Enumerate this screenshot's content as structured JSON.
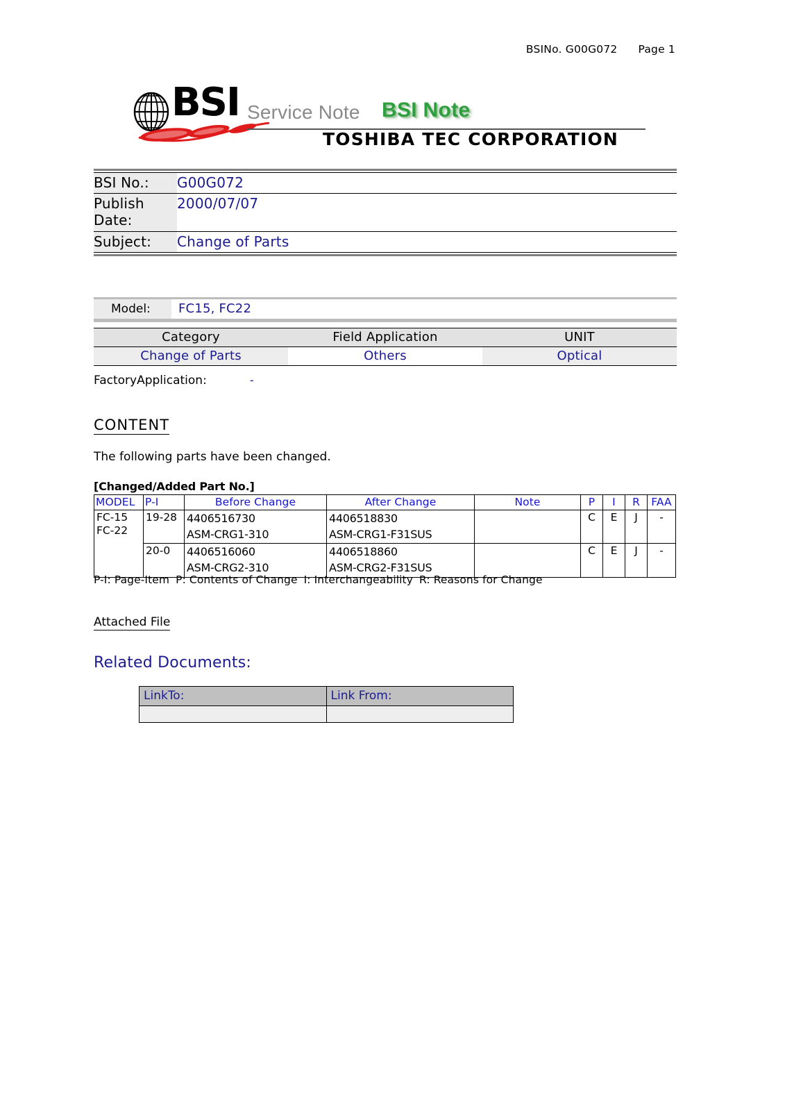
{
  "header": {
    "bsi_no_label": "BSINo. G00G072",
    "page_label": "Page 1"
  },
  "logo": {
    "bsi_word": "BSI",
    "service_note": "Service Note",
    "bsi_note": "BSI Note",
    "company": "TOSHIBA TEC CORPORATION",
    "globe_icon": "globe-icon",
    "swoosh_icon": "red-swoosh-icon"
  },
  "info": {
    "rows": [
      {
        "label": "BSI No.:",
        "value": "G00G072"
      },
      {
        "label_line1": "Publish",
        "label_line2": "Date:",
        "value": "2000/07/07"
      },
      {
        "label": "Subject:",
        "value": "Change of Parts"
      }
    ]
  },
  "model": {
    "label": "Model:",
    "value": "FC15, FC22"
  },
  "category_table": {
    "headers": [
      "Category",
      "Field Application",
      "UNIT"
    ],
    "values": [
      "Change of Parts",
      "Others",
      "Optical"
    ]
  },
  "factory": {
    "label": "FactoryApplication:",
    "value": "-"
  },
  "content": {
    "heading": "CONTENT",
    "body": "The following parts have been changed."
  },
  "parts": {
    "title": "[Changed/Added Part No.]",
    "headers": [
      "MODEL",
      "P-I",
      "Before Change",
      "After Change",
      "Note",
      "P",
      "I",
      "R",
      "FAA"
    ],
    "model_cell_line1": "FC-15",
    "model_cell_line2": "FC-22",
    "rows": [
      {
        "pi": "19-28",
        "before_line1": "4406516730",
        "before_line2": "ASM-CRG1-310",
        "after_line1": "4406518830",
        "after_line2": "ASM-CRG1-F31SUS",
        "note": "",
        "p": "C",
        "i": "E",
        "r": "J",
        "faa": "-"
      },
      {
        "pi": "20-0",
        "before_line1": "4406516060",
        "before_line2": "ASM-CRG2-310",
        "after_line1": "4406518860",
        "after_line2": "ASM-CRG2-F31SUS",
        "note": "",
        "p": "C",
        "i": "E",
        "r": "J",
        "faa": "-"
      }
    ],
    "legend_1": "P-I: Page-Item",
    "legend_2": "P: Contents of Change",
    "legend_3": "I: Interchangeability",
    "legend_4": "R: Reasons for Change"
  },
  "attached": {
    "label": "Attached File"
  },
  "related": {
    "heading": "Related Documents:",
    "headers": [
      "LinkTo:",
      "Link From:"
    ],
    "rows": [
      [
        "",
        ""
      ]
    ]
  },
  "colors": {
    "link_blue": "#1b1b8f",
    "header_blue": "#1515d0",
    "green": "#2f9e3f",
    "red": "#e01b1b",
    "gray_label": "#ebebeb",
    "gray_bar": "#bcbcbc",
    "table_head_gray": "#c0c0c0"
  }
}
